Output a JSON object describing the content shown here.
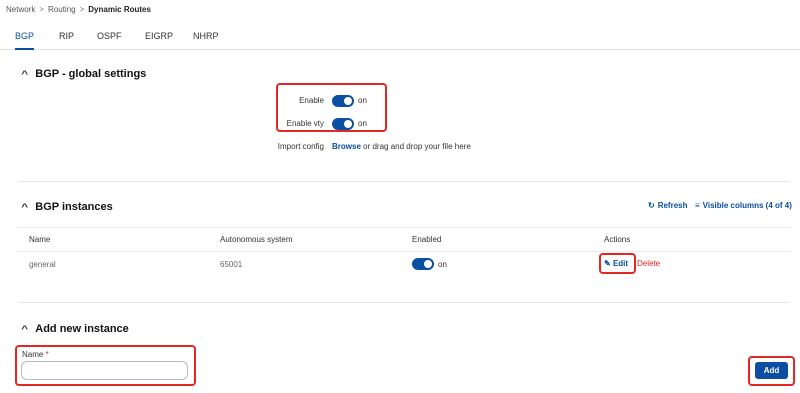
{
  "breadcrumb": {
    "items": [
      "Network",
      "Routing"
    ],
    "current": "Dynamic Routes"
  },
  "tabs": [
    {
      "label": "BGP",
      "active": true
    },
    {
      "label": "RIP",
      "active": false
    },
    {
      "label": "OSPF",
      "active": false
    },
    {
      "label": "EIGRP",
      "active": false
    },
    {
      "label": "NHRP",
      "active": false
    }
  ],
  "global_settings": {
    "title": "BGP - global settings",
    "enable_label": "Enable",
    "enable_value": "on",
    "enable_vty_label": "Enable vty",
    "enable_vty_value": "on",
    "import_label": "Import config",
    "browse_link": "Browse",
    "import_hint": "or drag and drop your file here"
  },
  "instances": {
    "title": "BGP instances",
    "refresh_label": "Refresh",
    "visible_columns_label": "Visible columns (4 of 4)",
    "columns": [
      "Name",
      "Autonomous system",
      "Enabled",
      "Actions"
    ],
    "rows": [
      {
        "name": "general",
        "as": "65001",
        "enabled": "on",
        "edit": "Edit",
        "delete": "Delete"
      }
    ]
  },
  "add_instance": {
    "title": "Add new instance",
    "name_label": "Name",
    "required_mark": "*",
    "name_value": "",
    "add_button": "Add"
  },
  "colors": {
    "accent": "#0b4ea2",
    "highlight": "#e32626"
  }
}
